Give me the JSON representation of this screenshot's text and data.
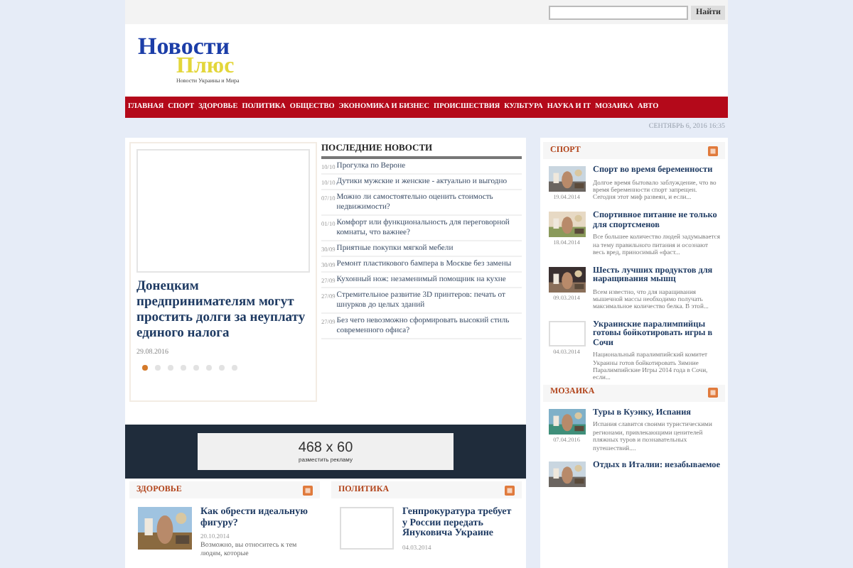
{
  "search": {
    "button": "Найти"
  },
  "logo": {
    "line1": "Новости",
    "line2": "Плюс",
    "tagline": "Новости Украины и Мира"
  },
  "nav": [
    "ГЛАВНАЯ",
    "СПОРТ",
    "ЗДОРОВЬЕ",
    "ПОЛИТИКА",
    "ОБЩЕСТВО",
    "ЭКОНОМИКА И БИЗНЕС",
    "ПРОИСШЕСТВИЯ",
    "КУЛЬТУРА",
    "НАУКА И IT",
    "МОЗАИКА",
    "АВТО"
  ],
  "date": "СЕНТЯБРЬ 6, 2016 16:35",
  "slider": {
    "title": "Донецким предпринимателям могут простить долги за неуплату единого налога",
    "date": "29.08.2016",
    "dots": [
      {
        "selected": true
      },
      {
        "selected": false
      },
      {
        "selected": false
      },
      {
        "selected": false
      },
      {
        "selected": false
      },
      {
        "selected": false
      },
      {
        "selected": false
      },
      {
        "selected": false
      }
    ]
  },
  "latest": {
    "heading": "ПОСЛЕДНИЕ НОВОСТИ",
    "items": [
      {
        "date": "10/10",
        "title": "Прогулка по Вероне"
      },
      {
        "date": "10/10",
        "title": "Дутики мужские и женские - актуально и выгодно"
      },
      {
        "date": "07/10",
        "title": "Можно ли самостоятельно оценить стоимость недвижимости?"
      },
      {
        "date": "01/10",
        "title": "Комфорт или функциональность для переговорной комнаты, что важнее?"
      },
      {
        "date": "30/09",
        "title": "Приятные покупки мягкой мебели"
      },
      {
        "date": "30/09",
        "title": "Ремонт пластикового бампера в Москве без замены"
      },
      {
        "date": "27/09",
        "title": "Кухонный нож: незаменимый помощник на кухне"
      },
      {
        "date": "27/09",
        "title": "Стремительное развитие 3D принтеров: печать от шнурков до целых зданий"
      },
      {
        "date": "27/09",
        "title": "Без чего невозможно сформировать высокий стиль современного офиса?"
      }
    ]
  },
  "ad": {
    "size": "468 x 60",
    "caption": "разместить рекламу"
  },
  "sidebar": [
    {
      "title": "СПОРТ",
      "items": [
        {
          "kind": "picture",
          "title": "Спорт во время беременности",
          "date": "19.04.2014",
          "excerpt": "Долгое время бытовало заблуждение, что во время беременности спорт запрещен. Сегодня этот миф развеян, и если..."
        },
        {
          "kind": "picture",
          "title": "Спортивное питание не только для спортсменов",
          "date": "18.04.2014",
          "excerpt": "Все большее количество людей задумывается на тему правильного питания и осознают весь вред, приносимый «фаст..."
        },
        {
          "kind": "picture",
          "title": "Шесть лучших продуктов для наращивания мышц",
          "date": "09.03.2014",
          "excerpt": "Всем известно, что для наращивания мышечной массы необходимо получать максимальное количество белка. В этой..."
        },
        {
          "kind": "placeholder",
          "title": "Украинские паралимпийцы готовы бойкотировать игры в Сочи",
          "date": "04.03.2014",
          "excerpt": "Национальный паралимпийский комитет Украины готов бойкотировать Зимние Паралимпийские Игры 2014 года в Сочи, если..."
        }
      ]
    },
    {
      "title": "МОЗАИКА",
      "items": [
        {
          "kind": "picture",
          "title": "Туры в Куэнку, Испания",
          "date": "07.04.2016",
          "excerpt": "Испания славится своими туристическими регионами, привлекающими ценителей пляжных туров и познавательных путешествий...."
        },
        {
          "kind": "picture",
          "title": "Отдых в Италии: незабываемое"
        }
      ]
    }
  ],
  "bottom": [
    {
      "title": "ЗДОРОВЬЕ",
      "item": {
        "kind": "picture",
        "title": "Как обрести идеальную фигуру?",
        "date": "20.10.2014",
        "excerpt": "Возможно, вы относитесь к тем людям, которые"
      }
    },
    {
      "title": "ПОЛИТИКА",
      "item": {
        "kind": "placeholder",
        "title": "Генпрокуратура требует у России передать Януковича Украине",
        "date": "04.03.2014"
      }
    }
  ]
}
